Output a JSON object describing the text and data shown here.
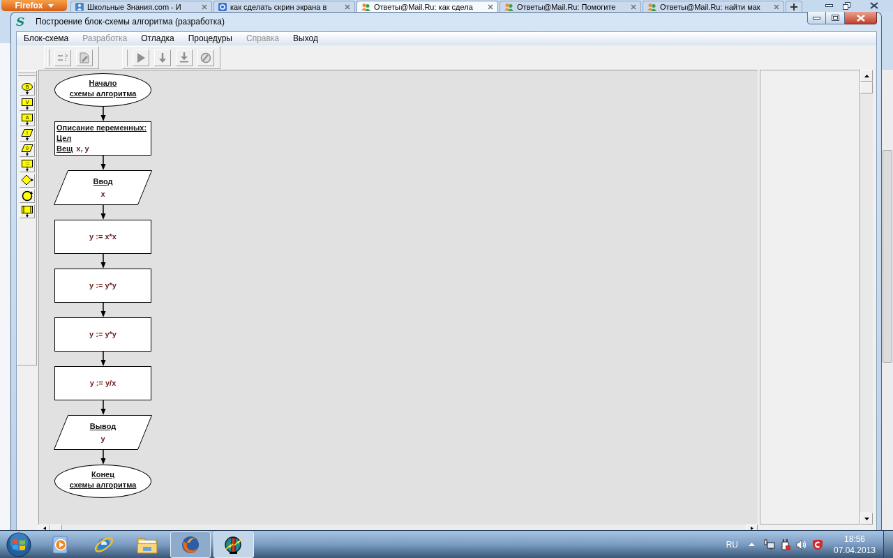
{
  "browser": {
    "menu_button": "Firefox",
    "tabs": [
      {
        "kind": "school",
        "title": "Школьные Знания.com - И",
        "selected": false
      },
      {
        "kind": "search",
        "title": "как сделать скрин экрана в",
        "selected": false
      },
      {
        "kind": "answers",
        "title": "Ответы@Mail.Ru: как сдела",
        "selected": true
      },
      {
        "kind": "answers",
        "title": "Ответы@Mail.Ru: Помогите",
        "selected": false
      },
      {
        "kind": "answers",
        "title": "Ответы@Mail.Ru: найти мак",
        "selected": false
      }
    ]
  },
  "window": {
    "logo": "S",
    "title": "Построение блок-схемы алгоритма (разработка)"
  },
  "menu": [
    {
      "label": "Блок-схема",
      "disabled": false
    },
    {
      "label": "Разработка",
      "disabled": true
    },
    {
      "label": "Отладка",
      "disabled": false
    },
    {
      "label": "Процедуры",
      "disabled": false
    },
    {
      "label": "Справка",
      "disabled": true
    },
    {
      "label": "Выход",
      "disabled": false
    }
  ],
  "toolbar": {
    "groups": [
      {
        "buttons": [
          {
            "kind": "lines",
            "disabled": true
          },
          {
            "kind": "document",
            "disabled": true
          }
        ]
      },
      {
        "buttons": [
          {
            "kind": "run",
            "disabled": true
          },
          {
            "kind": "step-into",
            "disabled": true
          },
          {
            "kind": "step-over",
            "disabled": true
          },
          {
            "kind": "stop",
            "disabled": true
          }
        ]
      }
    ]
  },
  "palette": [
    {
      "kind": "oval",
      "glyph": "B"
    },
    {
      "kind": "rect",
      "glyph": "V"
    },
    {
      "kind": "rect",
      "glyph": "A"
    },
    {
      "kind": "parallelogram",
      "glyph": "I"
    },
    {
      "kind": "parallelogram",
      "glyph": "0"
    },
    {
      "kind": "rect",
      "glyph": ":="
    },
    {
      "kind": "diamond"
    },
    {
      "kind": "circle"
    },
    {
      "kind": "procedure"
    }
  ],
  "flowchart": {
    "nodes": [
      {
        "kind": "terminal",
        "label": "Начало\nсхемы алгоритма"
      },
      {
        "kind": "declaration",
        "title": "Описание переменных:",
        "rows": [
          {
            "type": "Цел"
          },
          {
            "type": "Вещ",
            "vars": "x, y"
          }
        ]
      },
      {
        "kind": "io",
        "label": "Ввод",
        "value": "x"
      },
      {
        "kind": "process",
        "value": "y := x*x"
      },
      {
        "kind": "process",
        "value": "y := y*y"
      },
      {
        "kind": "process",
        "value": "y := y*y"
      },
      {
        "kind": "process",
        "value": "y := y/x"
      },
      {
        "kind": "io",
        "label": "Вывод",
        "value": "y"
      },
      {
        "kind": "terminal",
        "label": "Конец\nсхемы алгоритма"
      }
    ]
  },
  "taskbar": {
    "items": [
      {
        "kind": "media",
        "running": false,
        "active": false
      },
      {
        "kind": "ie",
        "running": false,
        "active": false
      },
      {
        "kind": "folder",
        "running": false,
        "active": false
      },
      {
        "kind": "firefox",
        "running": true,
        "active": false
      },
      {
        "kind": "app",
        "running": true,
        "active": true
      }
    ],
    "tray": {
      "language": "RU",
      "icons": [
        {
          "kind": "network"
        },
        {
          "kind": "power"
        },
        {
          "kind": "volume"
        },
        {
          "kind": "shield"
        }
      ]
    },
    "clock": {
      "time": "18:56",
      "date": "07.04.2013"
    }
  }
}
